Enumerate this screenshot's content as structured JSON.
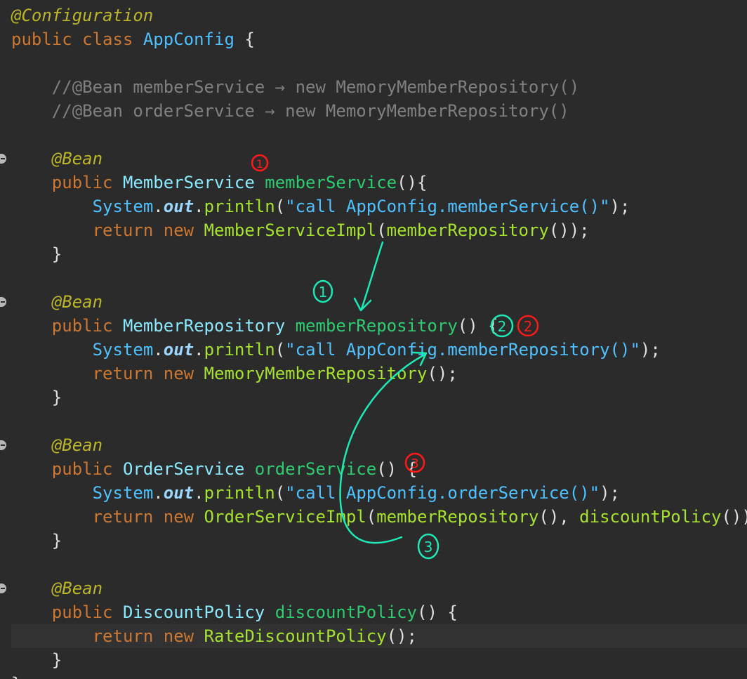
{
  "editor": {
    "lines": [
      [
        {
          "t": "@Configuration",
          "c": "annotation"
        }
      ],
      [
        {
          "t": "public class ",
          "c": "kw"
        },
        {
          "t": "AppConfig",
          "c": "cls2"
        },
        {
          "t": " {",
          "c": "plain"
        }
      ],
      [],
      [
        {
          "t": "    //@Bean memberService → new MemoryMemberRepository()",
          "c": "comment"
        }
      ],
      [
        {
          "t": "    //@Bean orderService → new MemoryMemberRepository()",
          "c": "comment"
        }
      ],
      [],
      [
        {
          "t": "    @Bean",
          "c": "annotation"
        }
      ],
      [
        {
          "t": "    public ",
          "c": "kw"
        },
        {
          "t": "MemberService",
          "c": "cls"
        },
        {
          "t": " ",
          "c": "plain"
        },
        {
          "t": "memberService",
          "c": "fndecl"
        },
        {
          "t": "(){",
          "c": "plain"
        }
      ],
      [
        {
          "t": "        ",
          "c": "plain"
        },
        {
          "t": "System",
          "c": "sys"
        },
        {
          "t": ".",
          "c": "plain"
        },
        {
          "t": "out",
          "c": "static"
        },
        {
          "t": ".",
          "c": "plain"
        },
        {
          "t": "println",
          "c": "fn"
        },
        {
          "t": "(",
          "c": "plain"
        },
        {
          "t": "\"call AppConfig.memberService()\"",
          "c": "str"
        },
        {
          "t": ");",
          "c": "plain"
        }
      ],
      [
        {
          "t": "        return new ",
          "c": "kw"
        },
        {
          "t": "MemberServiceImpl",
          "c": "fn"
        },
        {
          "t": "(",
          "c": "plain"
        },
        {
          "t": "memberRepository",
          "c": "fn"
        },
        {
          "t": "());",
          "c": "plain"
        }
      ],
      [
        {
          "t": "    }",
          "c": "plain"
        }
      ],
      [],
      [
        {
          "t": "    @Bean",
          "c": "annotation"
        }
      ],
      [
        {
          "t": "    public ",
          "c": "kw"
        },
        {
          "t": "MemberRepository",
          "c": "cls"
        },
        {
          "t": " ",
          "c": "plain"
        },
        {
          "t": "memberRepository",
          "c": "fndecl"
        },
        {
          "t": "() {",
          "c": "plain"
        }
      ],
      [
        {
          "t": "        ",
          "c": "plain"
        },
        {
          "t": "System",
          "c": "sys"
        },
        {
          "t": ".",
          "c": "plain"
        },
        {
          "t": "out",
          "c": "static"
        },
        {
          "t": ".",
          "c": "plain"
        },
        {
          "t": "println",
          "c": "fn"
        },
        {
          "t": "(",
          "c": "plain"
        },
        {
          "t": "\"call AppConfig.memberRepository()\"",
          "c": "str"
        },
        {
          "t": ");",
          "c": "plain"
        }
      ],
      [
        {
          "t": "        return new ",
          "c": "kw"
        },
        {
          "t": "MemoryMemberRepository",
          "c": "fn"
        },
        {
          "t": "();",
          "c": "plain"
        }
      ],
      [
        {
          "t": "    }",
          "c": "plain"
        }
      ],
      [],
      [
        {
          "t": "    @Bean",
          "c": "annotation"
        }
      ],
      [
        {
          "t": "    public ",
          "c": "kw"
        },
        {
          "t": "OrderService",
          "c": "cls"
        },
        {
          "t": " ",
          "c": "plain"
        },
        {
          "t": "orderService",
          "c": "fndecl"
        },
        {
          "t": "() {",
          "c": "plain"
        }
      ],
      [
        {
          "t": "        ",
          "c": "plain"
        },
        {
          "t": "System",
          "c": "sys"
        },
        {
          "t": ".",
          "c": "plain"
        },
        {
          "t": "out",
          "c": "static"
        },
        {
          "t": ".",
          "c": "plain"
        },
        {
          "t": "println",
          "c": "fn"
        },
        {
          "t": "(",
          "c": "plain"
        },
        {
          "t": "\"call AppConfig.orderService()\"",
          "c": "str"
        },
        {
          "t": ");",
          "c": "plain"
        }
      ],
      [
        {
          "t": "        return new ",
          "c": "kw"
        },
        {
          "t": "OrderServiceImpl",
          "c": "fn"
        },
        {
          "t": "(",
          "c": "plain"
        },
        {
          "t": "memberRepository",
          "c": "fn"
        },
        {
          "t": "(), ",
          "c": "plain"
        },
        {
          "t": "discountPolicy",
          "c": "fn"
        },
        {
          "t": "());",
          "c": "plain"
        }
      ],
      [
        {
          "t": "    }",
          "c": "plain"
        }
      ],
      [],
      [
        {
          "t": "    @Bean",
          "c": "annotation"
        }
      ],
      [
        {
          "t": "    public ",
          "c": "kw"
        },
        {
          "t": "DiscountPolicy",
          "c": "cls"
        },
        {
          "t": " ",
          "c": "plain"
        },
        {
          "t": "discountPolicy",
          "c": "fndecl"
        },
        {
          "t": "() {",
          "c": "plain"
        }
      ],
      [
        {
          "t": "        return new ",
          "c": "kw"
        },
        {
          "t": "RateDiscountPolicy",
          "c": "fn"
        },
        {
          "t": "();",
          "c": "plain"
        }
      ],
      [
        {
          "t": "    }",
          "c": "plain"
        }
      ],
      [
        {
          "t": "}",
          "c": "plain"
        }
      ]
    ],
    "current_line": 26,
    "bean_marker_lines": [
      6,
      12,
      18,
      24
    ]
  },
  "annotations": {
    "red_color": "#ff1a1a",
    "green_color": "#1de9b6",
    "red_marks": [
      "1",
      "2",
      "3"
    ],
    "green_marks": [
      "1",
      "2",
      "3"
    ]
  }
}
